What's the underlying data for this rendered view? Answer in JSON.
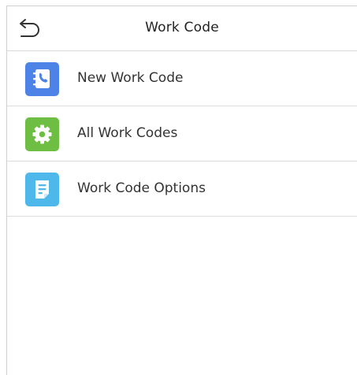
{
  "header": {
    "title": "Work Code",
    "back_icon": "back-arrow-icon"
  },
  "menu": {
    "items": [
      {
        "label": "New Work Code",
        "icon": "phone-book-icon",
        "icon_color": "#4d83e6"
      },
      {
        "label": "All Work Codes",
        "icon": "gear-icon",
        "icon_color": "#6fbe44"
      },
      {
        "label": "Work Code Options",
        "icon": "document-edit-icon",
        "icon_color": "#4fb8ea"
      }
    ]
  },
  "colors": {
    "text": "#333333",
    "divider": "#dcdcdc",
    "background": "#ffffff"
  }
}
